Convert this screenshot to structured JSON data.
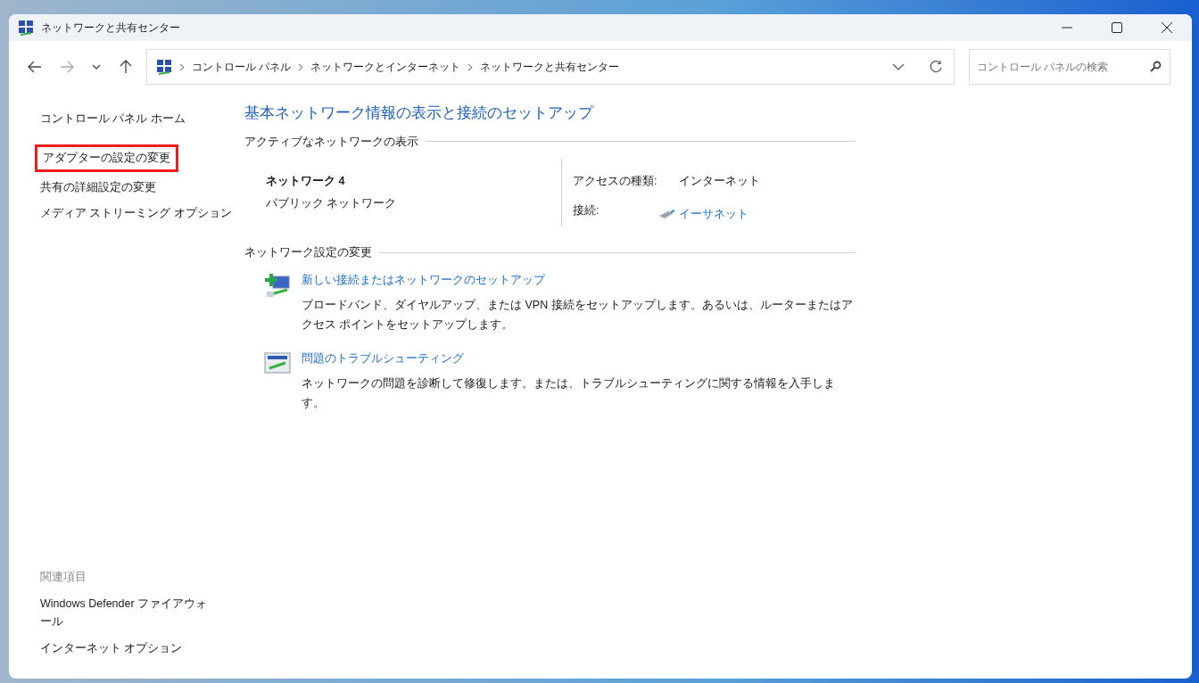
{
  "window": {
    "title": "ネットワークと共有センター"
  },
  "address_bar": {
    "crumbs": [
      "コントロール パネル",
      "ネットワークとインターネット",
      "ネットワークと共有センター"
    ]
  },
  "search": {
    "placeholder": "コントロール パネルの検索"
  },
  "sidebar": {
    "items": [
      {
        "label": "コントロール パネル ホーム",
        "highlighted": false
      },
      {
        "label": "アダプターの設定の変更",
        "highlighted": true
      },
      {
        "label": "共有の詳細設定の変更",
        "highlighted": false
      },
      {
        "label": "メディア ストリーミング オプション",
        "highlighted": false
      }
    ],
    "related_heading": "関連項目",
    "related": [
      "Windows Defender ファイアウォール",
      "インターネット オプション"
    ]
  },
  "main": {
    "title": "基本ネットワーク情報の表示と接続のセットアップ",
    "active_heading": "アクティブなネットワークの表示",
    "network": {
      "name": "ネットワーク 4",
      "type": "パブリック ネットワーク",
      "access_label": "アクセスの種類:",
      "access_value": "インターネット",
      "connection_label": "接続:",
      "connection_value": "イーサネット"
    },
    "change_heading": "ネットワーク設定の変更",
    "tasks": [
      {
        "kind": "new",
        "link": "新しい接続またはネットワークのセットアップ",
        "description": "ブロードバンド、ダイヤルアップ、または VPN 接続をセットアップします。あるいは、ルーターまたはアクセス ポイントをセットアップします。"
      },
      {
        "kind": "troubleshoot",
        "link": "問題のトラブルシューティング",
        "description": "ネットワークの問題を診断して修復します。または、トラブルシューティングに関する情報を入手します。"
      }
    ]
  }
}
